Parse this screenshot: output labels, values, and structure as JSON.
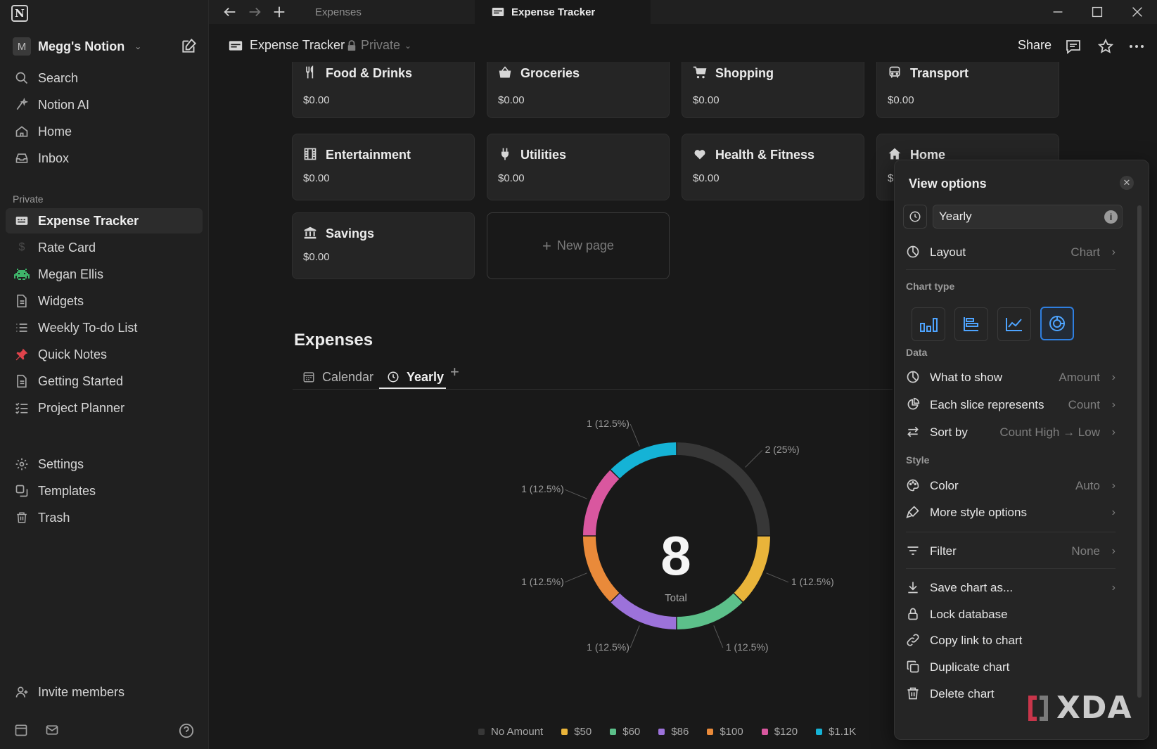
{
  "app": {
    "logo": "N",
    "workspace_initial": "M",
    "workspace_name": "Megg's Notion"
  },
  "sidebar": {
    "top_items": [
      {
        "label": "Search",
        "icon": "search-icon"
      },
      {
        "label": "Notion AI",
        "icon": "notion-ai-icon"
      },
      {
        "label": "Home",
        "icon": "home-icon"
      },
      {
        "label": "Inbox",
        "icon": "inbox-icon"
      }
    ],
    "section_label": "Private",
    "private_items": [
      {
        "label": "Expense Tracker",
        "icon": "expense-tracker-icon",
        "active": true
      },
      {
        "label": "Rate Card",
        "icon": "dollar-icon"
      },
      {
        "label": "Megan Ellis",
        "icon": "space-invader-icon"
      },
      {
        "label": "Widgets",
        "icon": "page-icon"
      },
      {
        "label": "Weekly To-do List",
        "icon": "list-icon"
      },
      {
        "label": "Quick Notes",
        "icon": "pushpin-icon"
      },
      {
        "label": "Getting Started",
        "icon": "page-icon"
      },
      {
        "label": "Project Planner",
        "icon": "checklist-icon"
      }
    ],
    "bottom_items": [
      {
        "label": "Settings",
        "icon": "gear-icon"
      },
      {
        "label": "Templates",
        "icon": "templates-icon"
      },
      {
        "label": "Trash",
        "icon": "trash-icon"
      }
    ],
    "invite_label": "Invite members"
  },
  "tabs": {
    "inactive": "Expenses",
    "active": "Expense Tracker"
  },
  "page": {
    "breadcrumb": "Expense Tracker",
    "privacy": "Private",
    "share_label": "Share"
  },
  "cards": [
    {
      "name": "Food & Drinks",
      "amount": "$0.00",
      "icon": "fork-knife-icon"
    },
    {
      "name": "Groceries",
      "amount": "$0.00",
      "icon": "basket-icon"
    },
    {
      "name": "Shopping",
      "amount": "$0.00",
      "icon": "cart-icon"
    },
    {
      "name": "Transport",
      "amount": "$0.00",
      "icon": "bus-icon"
    },
    {
      "name": "Entertainment",
      "amount": "$0.00",
      "icon": "film-icon"
    },
    {
      "name": "Utilities",
      "amount": "$0.00",
      "icon": "plug-icon"
    },
    {
      "name": "Health & Fitness",
      "amount": "$0.00",
      "icon": "heart-icon"
    },
    {
      "name": "Home",
      "amount": "$",
      "icon": "house-icon"
    },
    {
      "name": "Savings",
      "amount": "$0.00",
      "icon": "bank-icon"
    }
  ],
  "new_page_label": "New page",
  "expenses": {
    "title": "Expenses",
    "views": [
      {
        "label": "Calendar",
        "icon": "calendar-icon"
      },
      {
        "label": "Yearly",
        "icon": "clock-icon",
        "active": true
      }
    ]
  },
  "chart_data": {
    "type": "pie",
    "donut": true,
    "center_value": "8",
    "center_label": "Total",
    "categories": [
      "No Amount",
      "$50",
      "$60",
      "$86",
      "$100",
      "$120",
      "$1.1K"
    ],
    "values": [
      2,
      1,
      1,
      1,
      1,
      1,
      1
    ],
    "labels": [
      "2 (25%)",
      "1 (12.5%)",
      "1 (12.5%)",
      "1 (12.5%)",
      "1 (12.5%)",
      "1 (12.5%)",
      "1 (12.5%)"
    ],
    "colors": [
      "#373737",
      "#e9b43a",
      "#5cc08a",
      "#9c72da",
      "#e98a3a",
      "#d9579f",
      "#15b3d6"
    ],
    "legend_position": "bottom"
  },
  "view_options": {
    "title": "View options",
    "view_name": "Yearly",
    "layout_label": "Layout",
    "layout_value": "Chart",
    "chart_type_label": "Chart type",
    "data_label": "Data",
    "what_to_show_label": "What to show",
    "what_to_show_value": "Amount",
    "slice_label": "Each slice represents",
    "slice_value": "Count",
    "sort_label": "Sort by",
    "sort_value": "Count High → Low",
    "style_label": "Style",
    "color_label": "Color",
    "color_value": "Auto",
    "more_style_label": "More style options",
    "filter_label": "Filter",
    "filter_value": "None",
    "save_label": "Save chart as...",
    "lock_label": "Lock database",
    "copy_link_label": "Copy link to chart",
    "duplicate_label": "Duplicate chart",
    "delete_label": "Delete chart"
  },
  "watermark": "XDA"
}
